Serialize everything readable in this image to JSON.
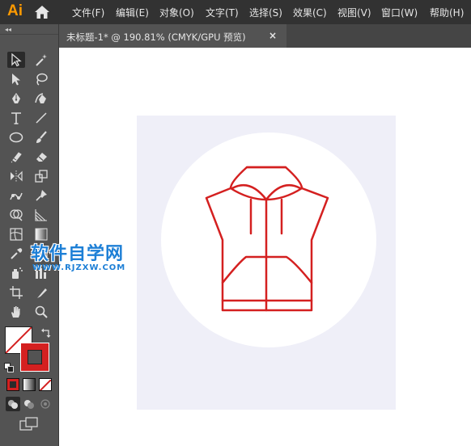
{
  "app": {
    "logo": "Ai",
    "accent": "#ff9a00"
  },
  "menu": [
    "文件(F)",
    "编辑(E)",
    "对象(O)",
    "文字(T)",
    "选择(S)",
    "效果(C)",
    "视图(V)",
    "窗口(W)",
    "帮助(H)"
  ],
  "panel": {
    "collapse": "◂◂"
  },
  "tab": {
    "title": "未标题-1* @ 190.81% (CMYK/GPU 预览)",
    "close": "×"
  },
  "tools": [
    "selection-tool",
    "magic-wand-tool",
    "direct-selection-tool",
    "lasso-tool",
    "pen-tool",
    "curvature-tool",
    "type-tool",
    "line-segment-tool",
    "ellipse-tool",
    "paintbrush-tool",
    "shaper-tool",
    "eraser-tool",
    "reflect-tool",
    "scale-tool",
    "puppet-warp-tool",
    "pin-tool",
    "shape-builder-tool",
    "perspective-grid-tool",
    "mesh-tool",
    "gradient-tool",
    "eyedropper-tool",
    "blend-tool",
    "symbol-sprayer-tool",
    "column-graph-tool",
    "artboard-tool",
    "slice-tool",
    "hand-tool",
    "zoom-tool"
  ],
  "colors": {
    "fill": "#ffffff",
    "stroke": "#d42020",
    "art_stroke": "#d42020",
    "artboard_bg": "#efeff8",
    "circle": "#ffffff"
  },
  "watermark": {
    "main": "软件自学网",
    "sub": "WWW.RJZXW.COM"
  }
}
